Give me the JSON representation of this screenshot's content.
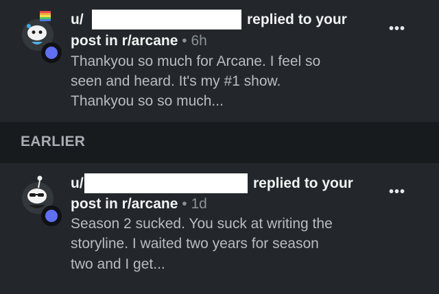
{
  "notifications": [
    {
      "user_prefix": "u/",
      "action": "replied to your",
      "target": "post in r/arcane",
      "separator": "•",
      "time": "6h",
      "preview_lines": [
        "Thankyou so much for Arcane. I feel so",
        "seen and heard. It's my #1 show.",
        "Thankyou so so much..."
      ],
      "menu_label": "•••"
    },
    {
      "user_prefix": "u/",
      "action": "replied to your",
      "target": "post in r/arcane",
      "separator": "•",
      "time": "1d",
      "preview_lines": [
        "Season 2 sucked. You suck at writing the",
        "storyline. I waited two years for season",
        "two and I get..."
      ],
      "menu_label": "•••"
    }
  ],
  "section_header": "EARLIER",
  "colors": {
    "background": "#23272b",
    "section_background": "#181b1e",
    "status_badge": "#5e6ff2",
    "redaction": "#ffffff"
  }
}
